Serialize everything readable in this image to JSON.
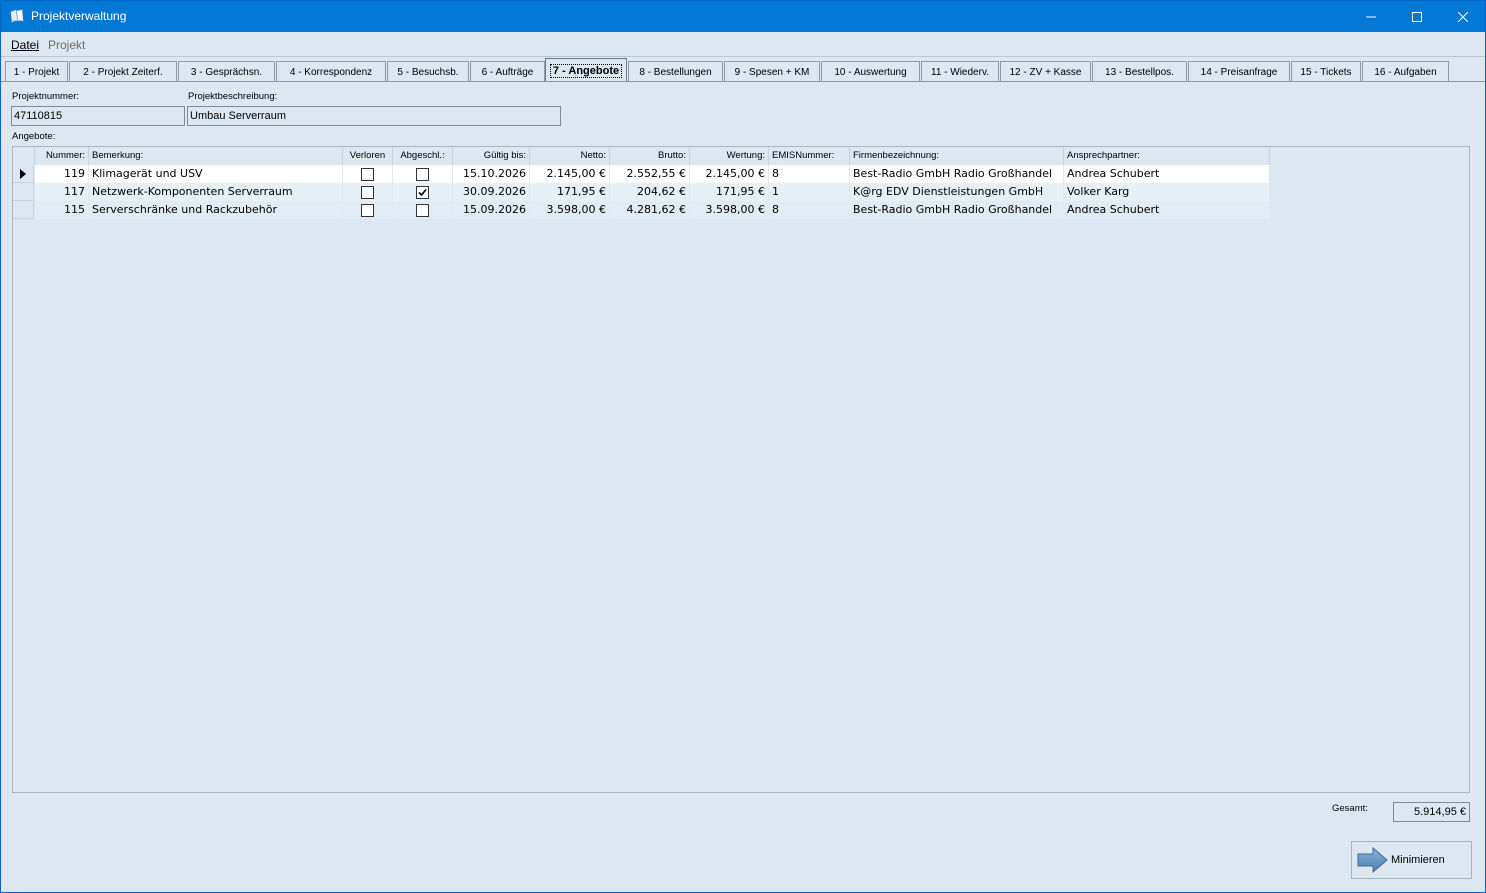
{
  "window": {
    "title": "Projektverwaltung"
  },
  "menu": {
    "datei": "Datei",
    "projekt": "Projekt"
  },
  "tabs": [
    "1 - Projekt",
    "2 - Projekt Zeiterf.",
    "3 - Gesprächsn.",
    "4 - Korrespondenz",
    "5 - Besuchsb.",
    "6 - Aufträge",
    "7 - Angebote",
    "8 - Bestellungen",
    "9 - Spesen + KM",
    "10 - Auswertung",
    "11 - Wiederv.",
    "12 - ZV + Kasse",
    "13 - Bestellpos.",
    "14 - Preisanfrage",
    "15 - Tickets",
    "16 - Aufgaben"
  ],
  "active_tab": "7 - Angebote",
  "form": {
    "projektnummer_label": "Projektnummer:",
    "projektnummer": "47110815",
    "projektbeschreibung_label": "Projektbeschreibung:",
    "projektbeschreibung": "Umbau Serverraum",
    "angebote_label": "Angebote:"
  },
  "grid": {
    "headers": {
      "nummer": "Nummer:",
      "bemerkung": "Bemerkung:",
      "verloren": "Verloren",
      "abgeschl": "Abgeschl.:",
      "gueltig": "Gültig bis:",
      "netto": "Netto:",
      "brutto": "Brutto:",
      "wertung": "Wertung:",
      "emis": "EMISNummer:",
      "firma": "Firmenbezeichnung:",
      "ansprech": "Ansprechpartner:"
    },
    "rows": [
      {
        "nummer": "119",
        "bemerkung": "Klimagerät und USV",
        "verloren": false,
        "abgeschl": false,
        "gueltig": "15.10.2026",
        "netto": "2.145,00 €",
        "brutto": "2.552,55 €",
        "wertung": "2.145,00 €",
        "emis": "8",
        "firma": "Best-Radio GmbH Radio Großhandel",
        "ansprech": "Andrea Schubert"
      },
      {
        "nummer": "117",
        "bemerkung": "Netzwerk-Komponenten Serverraum",
        "verloren": false,
        "abgeschl": true,
        "gueltig": "30.09.2026",
        "netto": "171,95 €",
        "brutto": "204,62 €",
        "wertung": "171,95 €",
        "emis": "1",
        "firma": "K@rg EDV Dienstleistungen GmbH",
        "ansprech": "Volker Karg"
      },
      {
        "nummer": "115",
        "bemerkung": "Serverschränke und Rackzubehör",
        "verloren": false,
        "abgeschl": false,
        "gueltig": "15.09.2026",
        "netto": "3.598,00 €",
        "brutto": "4.281,62 €",
        "wertung": "3.598,00 €",
        "emis": "8",
        "firma": "Best-Radio GmbH Radio Großhandel",
        "ansprech": "Andrea Schubert"
      }
    ]
  },
  "footer": {
    "gesamt_label": "Gesamt:",
    "gesamt_value": "5.914,95 €",
    "minimize_label": "Minimieren"
  },
  "icons": {
    "app": "books-icon",
    "minimize": "window-minimize-icon",
    "maximize": "window-maximize-icon",
    "close": "window-close-icon",
    "arrow": "arrow-right-icon",
    "row_indicator": "current-row-icon",
    "check": "checkmark-icon"
  },
  "colors": {
    "titlebar": "#0078d4",
    "background": "#dce7f1"
  }
}
